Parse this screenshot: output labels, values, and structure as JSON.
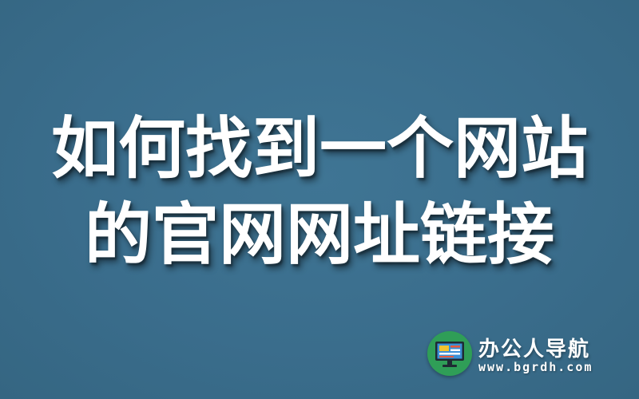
{
  "headline": {
    "line1": "如何找到一个网站",
    "line2": "的官网网址链接"
  },
  "brand": {
    "name": "办公人导航",
    "url": "www.bgrdh.com",
    "logo_icon": "monitor-icon"
  },
  "colors": {
    "background": "#3a6d8c",
    "text": "#ffffff",
    "logo_green": "#2f9e57"
  }
}
